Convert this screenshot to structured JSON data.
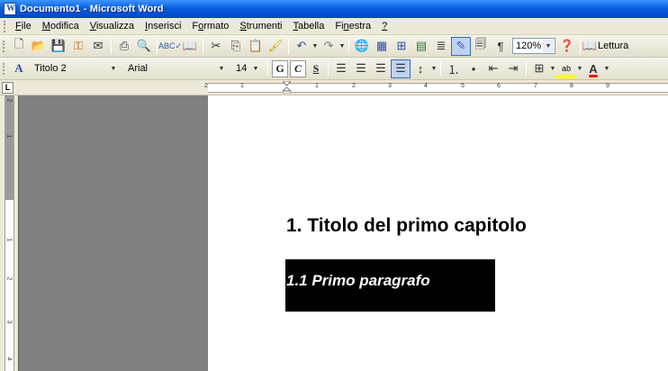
{
  "window": {
    "title": "Documento1 - Microsoft Word"
  },
  "menu": {
    "items": [
      {
        "label": "File",
        "mnemonic": "F"
      },
      {
        "label": "Modifica",
        "mnemonic": "M"
      },
      {
        "label": "Visualizza",
        "mnemonic": "V"
      },
      {
        "label": "Inserisci",
        "mnemonic": "I"
      },
      {
        "label": "Formato",
        "mnemonic": "o"
      },
      {
        "label": "Strumenti",
        "mnemonic": "S"
      },
      {
        "label": "Tabella",
        "mnemonic": "T"
      },
      {
        "label": "Finestra",
        "mnemonic": "n"
      },
      {
        "label": "?",
        "mnemonic": "?"
      }
    ]
  },
  "standard_toolbar": {
    "zoom_value": "120%",
    "reading_label": "Lettura",
    "icons": [
      "new-document-icon",
      "open-icon",
      "save-icon",
      "permission-icon",
      "email-icon",
      "print-icon",
      "print-preview-icon",
      "spelling-icon",
      "research-icon",
      "cut-icon",
      "copy-icon",
      "paste-icon",
      "format-painter-icon",
      "undo-icon",
      "redo-icon",
      "hyperlink-icon",
      "tables-borders-icon",
      "insert-table-icon",
      "insert-excel-icon",
      "columns-icon",
      "drawing-icon",
      "document-map-icon",
      "show-hide-icon",
      "help-icon",
      "reading-icon"
    ]
  },
  "formatting_toolbar": {
    "style_value": "Titolo 2",
    "font_value": "Arial",
    "size_value": "14",
    "bold_label": "G",
    "italic_label": "C",
    "underline_label": "S",
    "highlight_label": "ab",
    "font_color_label": "A"
  },
  "ruler": {
    "corner_label": "L",
    "h_ticks": [
      "2",
      "1",
      "1",
      "2",
      "3",
      "4",
      "5",
      "6",
      "7",
      "8",
      "9"
    ],
    "v_ticks": [
      "2",
      "1",
      "1",
      "2",
      "3",
      "4"
    ]
  },
  "document": {
    "heading1": "1. Titolo del primo capitolo",
    "heading2": "1.1 Primo paragrafo"
  },
  "colors": {
    "titlebar": "#0a5fe0",
    "chrome": "#ece9d8",
    "workspace": "#808080",
    "selection": "#000000"
  }
}
